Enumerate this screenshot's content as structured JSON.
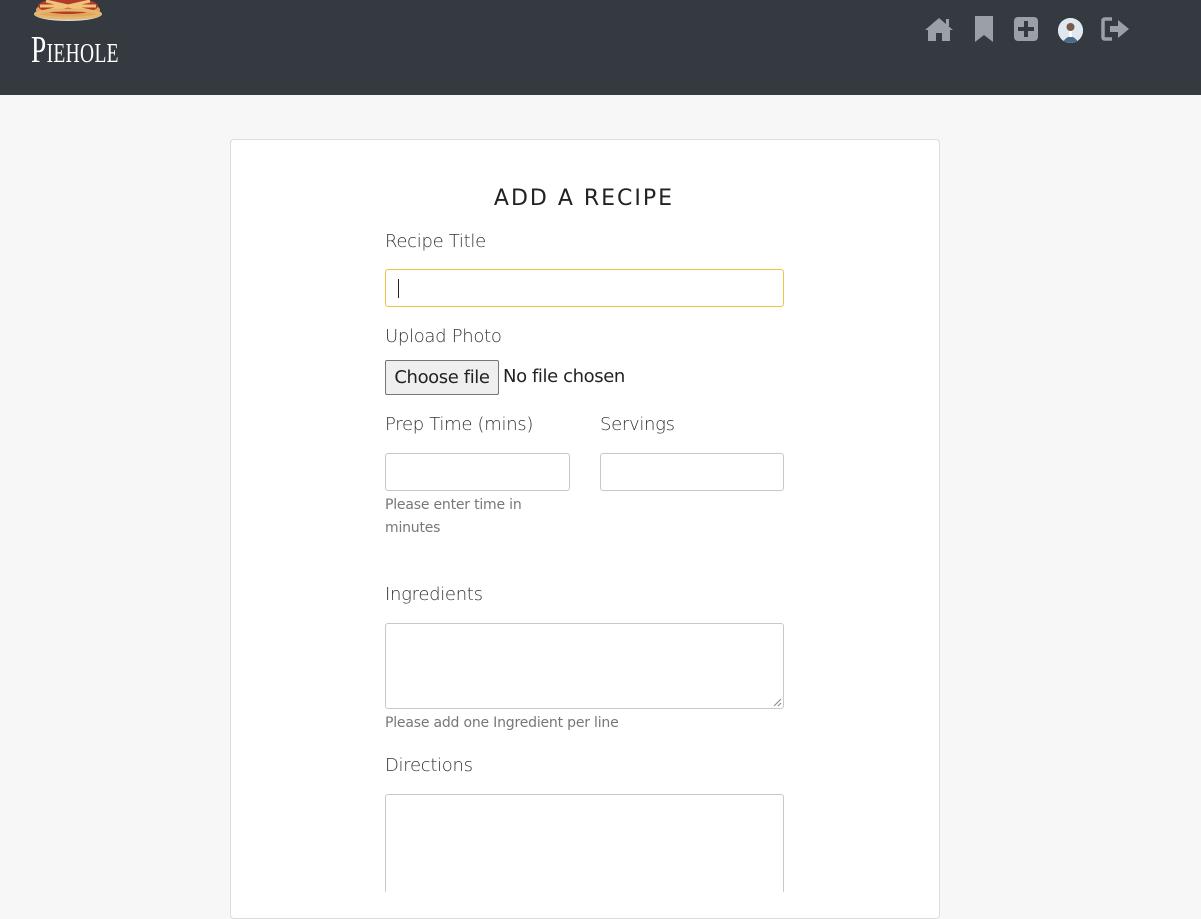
{
  "brand": {
    "name": "Piehole"
  },
  "nav": {
    "icons": [
      "home-icon",
      "bookmark-icon",
      "plus-square-icon",
      "avatar",
      "sign-out-icon"
    ],
    "icon_color": "#9aa0a6",
    "bar_color": "#343a40"
  },
  "form": {
    "title": "ADD A RECIPE",
    "recipe_title_label": "Recipe Title",
    "recipe_title_value": "",
    "upload_label": "Upload Photo",
    "choose_file_button": "Choose file",
    "file_status": "No file chosen",
    "prep_time_label": "Prep Time (mins)",
    "prep_time_value": "",
    "prep_time_help": "Please enter time in minutes",
    "servings_label": "Servings",
    "servings_value": "",
    "ingredients_label": "Ingredients",
    "ingredients_value": "",
    "ingredients_help": "Please add one Ingredient per line",
    "directions_label": "Directions",
    "directions_value": "",
    "focus_color": "#e8c547"
  }
}
